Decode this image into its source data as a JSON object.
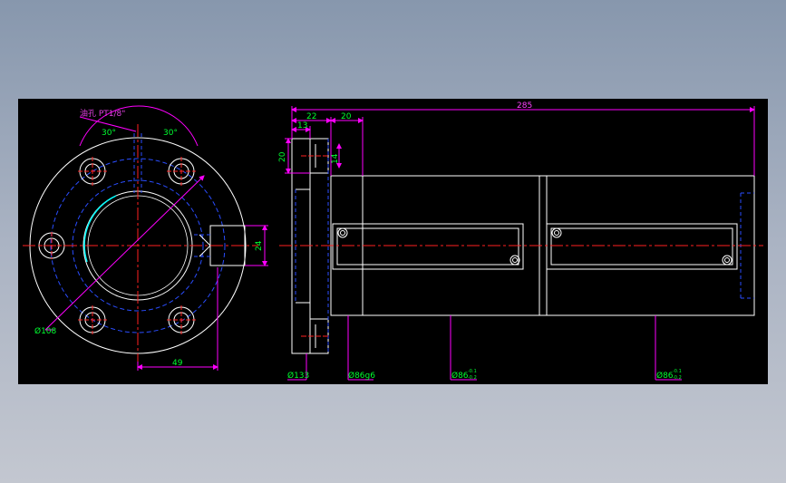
{
  "colors": {
    "background": "#000000",
    "outline": "#ffffff",
    "center_line": "#ff2020",
    "hidden_line": "#2a4dff",
    "dimension_line": "#ff00ff",
    "dimension_text_magenta": "#ff40ff",
    "dimension_text_green": "#00ff30",
    "label_text": "#e040e0",
    "bore_highlight": "#00ffff"
  },
  "front_view": {
    "note_label": "油孔 PT1/8\"",
    "angle_left": "30°",
    "angle_right": "30°",
    "dim_pcd": "Ø108",
    "dim_offset": "49",
    "dim_port": "24"
  },
  "side_view": {
    "dim_total": "285",
    "dim_flange": "22",
    "dim_step": "13",
    "dim_neck": "20",
    "dim_height": "20",
    "dim_inner": "14",
    "dim_flange_dia": "Ø133",
    "dim_body_dia": "Ø86g6",
    "dim_nut1_dia": "Ø86",
    "dim_nut1_tol_upper": "-0.1",
    "dim_nut1_tol_lower": "-0.2",
    "dim_nut2_dia": "Ø86",
    "dim_nut2_tol_upper": "-0.1",
    "dim_nut2_tol_lower": "-0.2"
  }
}
